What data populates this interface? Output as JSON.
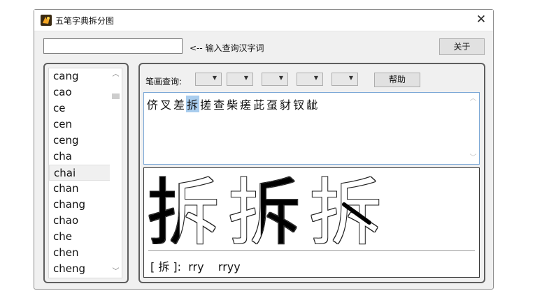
{
  "window": {
    "title": "五笔字典拆分图",
    "close_label": "✕"
  },
  "query": {
    "value": "",
    "hint": "<-- 输入查询汉字词",
    "about_label": "关于"
  },
  "pinyin_list": {
    "items": [
      "cang",
      "cao",
      "ce",
      "cen",
      "ceng",
      "cha",
      "chai",
      "chan",
      "chang",
      "chao",
      "che",
      "chen",
      "cheng"
    ],
    "selected": "chai"
  },
  "stroke_query": {
    "label": "笔画查询:",
    "help_label": "帮助"
  },
  "characters": {
    "items": [
      "侪",
      "叉",
      "差",
      "拆",
      "搓",
      "查",
      "柴",
      "瘥",
      "茈",
      "虿",
      "豺",
      "钗",
      "龇"
    ],
    "highlighted": "拆"
  },
  "decomposition": {
    "glyph": "拆",
    "line": "[ 拆 ]:  rry    rryy"
  },
  "colors": {
    "highlight": "#a9cdee",
    "selection_border": "#7aa7d6"
  }
}
